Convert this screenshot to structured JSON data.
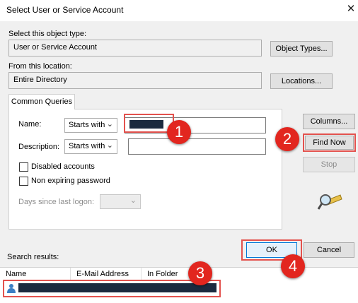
{
  "window": {
    "title": "Select User or Service Account",
    "close_glyph": "✕"
  },
  "object_type": {
    "label": "Select this object type:",
    "value": "User or Service Account",
    "button": "Object Types..."
  },
  "location": {
    "label": "From this location:",
    "value": "Entire Directory",
    "button": "Locations..."
  },
  "queries": {
    "tab": "Common Queries",
    "name_label": "Name:",
    "name_operator": "Starts with",
    "description_label": "Description:",
    "description_operator": "Starts with",
    "disabled_accounts": "Disabled accounts",
    "non_expiring_password": "Non expiring password",
    "days_label": "Days since last logon:"
  },
  "side_buttons": {
    "columns": "Columns...",
    "find_now": "Find Now",
    "stop": "Stop"
  },
  "dialog_buttons": {
    "ok": "OK",
    "cancel": "Cancel"
  },
  "results": {
    "label": "Search results:",
    "columns": [
      "Name",
      "E-Mail Address",
      "In Folder"
    ]
  },
  "annotations": [
    "1",
    "2",
    "3",
    "4"
  ],
  "colors": {
    "annotation_red": "#e2261f",
    "highlight_border": "#e3524e",
    "redaction": "#1b2a3f"
  }
}
